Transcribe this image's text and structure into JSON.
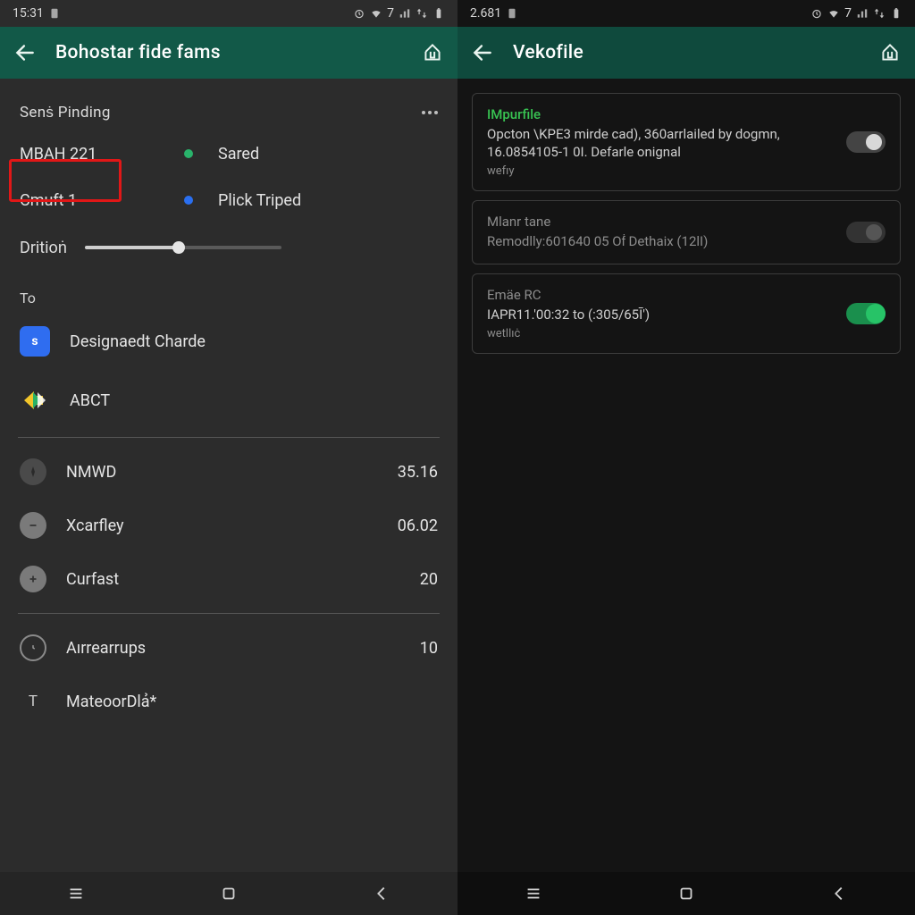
{
  "left": {
    "status": {
      "time": "15:31",
      "signal": "7"
    },
    "appbar": {
      "title": "Bohostar fide fams"
    },
    "section": {
      "header": "Senṡ Pinding",
      "row1": {
        "left": "MBAH 221",
        "right": "Sared"
      },
      "row2": {
        "left": "Cmuft 1",
        "right": "Plick Triped"
      },
      "slider_label": "Dritioṅ"
    },
    "to_label": "To",
    "to_items": [
      {
        "label": "Designaedt Charde"
      },
      {
        "label": "ABCT"
      }
    ],
    "stats": [
      {
        "label": "NMWD",
        "value": "35.16"
      },
      {
        "label": "Xcarfley",
        "value": "06.02"
      },
      {
        "label": "Curfast",
        "value": "20"
      }
    ],
    "footer": [
      {
        "label": "Aırrearrups",
        "value": "10"
      },
      {
        "label": "MateoorDlả*",
        "value": ""
      }
    ]
  },
  "right": {
    "status": {
      "time": "2.681",
      "signal": "7"
    },
    "appbar": {
      "title": "Vekofile"
    },
    "cards": [
      {
        "title": "IMpurfile",
        "desc": "Opcton \\KPE3 mirde cad), 360arrlailed by dogmn, 16.0854105-1 0I. Defarle onignal",
        "sub": "wefıy",
        "state": "off",
        "variant": "green"
      },
      {
        "title": "Mlanr tane",
        "desc": "Remodlly:601640 05 Oḟ Dethaix (12lI)",
        "sub": "",
        "state": "dis",
        "variant": "grey"
      },
      {
        "title": "Emäe RC",
        "desc": "IAPR11.'00:32 to (:305/65Ī')",
        "sub": "wetllıċ",
        "state": "on",
        "variant": "grey"
      }
    ]
  }
}
